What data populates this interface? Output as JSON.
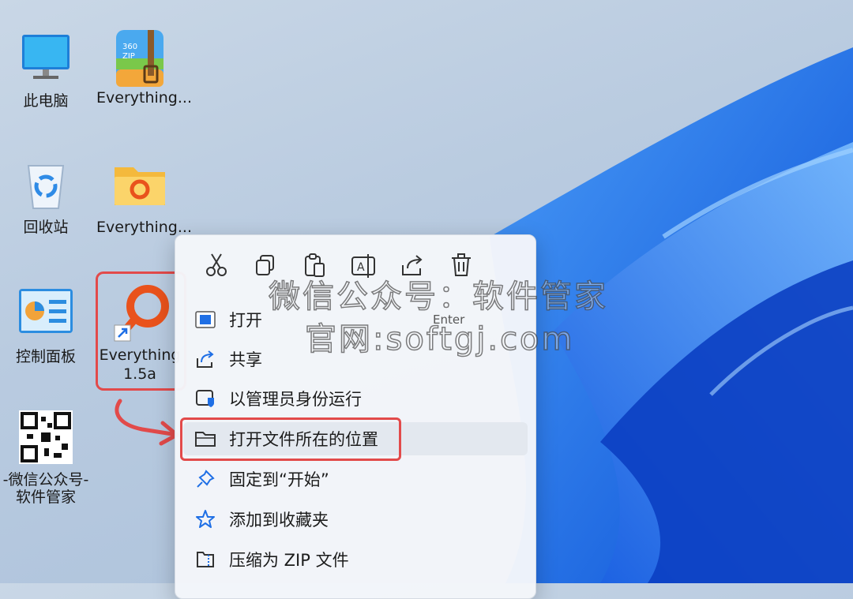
{
  "desktop": {
    "icons": [
      {
        "label": "此电脑",
        "icon": "monitor-icon"
      },
      {
        "label": "Everything...",
        "icon": "zip-archive-icon"
      },
      {
        "label": "回收站",
        "icon": "recycle-bin-icon"
      },
      {
        "label": "Everything...",
        "icon": "folder-icon"
      },
      {
        "label": "控制面板",
        "icon": "control-panel-icon"
      },
      {
        "label": "Everything",
        "label2": "1.5a",
        "icon": "everything-search-icon"
      },
      {
        "label": "-微信公众号-",
        "label2": "软件管家",
        "icon": "qr-code-icon"
      }
    ]
  },
  "context_menu": {
    "quick_actions": [
      "cut-icon",
      "copy-icon",
      "paste-icon",
      "rename-icon",
      "share-icon",
      "delete-icon"
    ],
    "items": [
      {
        "label": "打开",
        "shortcut": "Enter",
        "icon": "open-app-icon"
      },
      {
        "label": "共享",
        "icon": "share-icon"
      },
      {
        "label": "以管理员身份运行",
        "icon": "admin-shield-icon"
      },
      {
        "label": "打开文件所在的位置",
        "icon": "folder-outline-icon"
      },
      {
        "label": "固定到“开始”",
        "icon": "pin-icon"
      },
      {
        "label": "添加到收藏夹",
        "icon": "star-icon"
      },
      {
        "label": "压缩为 ZIP 文件",
        "icon": "zip-file-icon"
      }
    ]
  },
  "watermark": {
    "line1": "微信公众号：软件管家",
    "line2": "官网:softgj.com"
  },
  "colors": {
    "accent": "#1f6fe5",
    "highlight_box": "#e24a4a"
  }
}
